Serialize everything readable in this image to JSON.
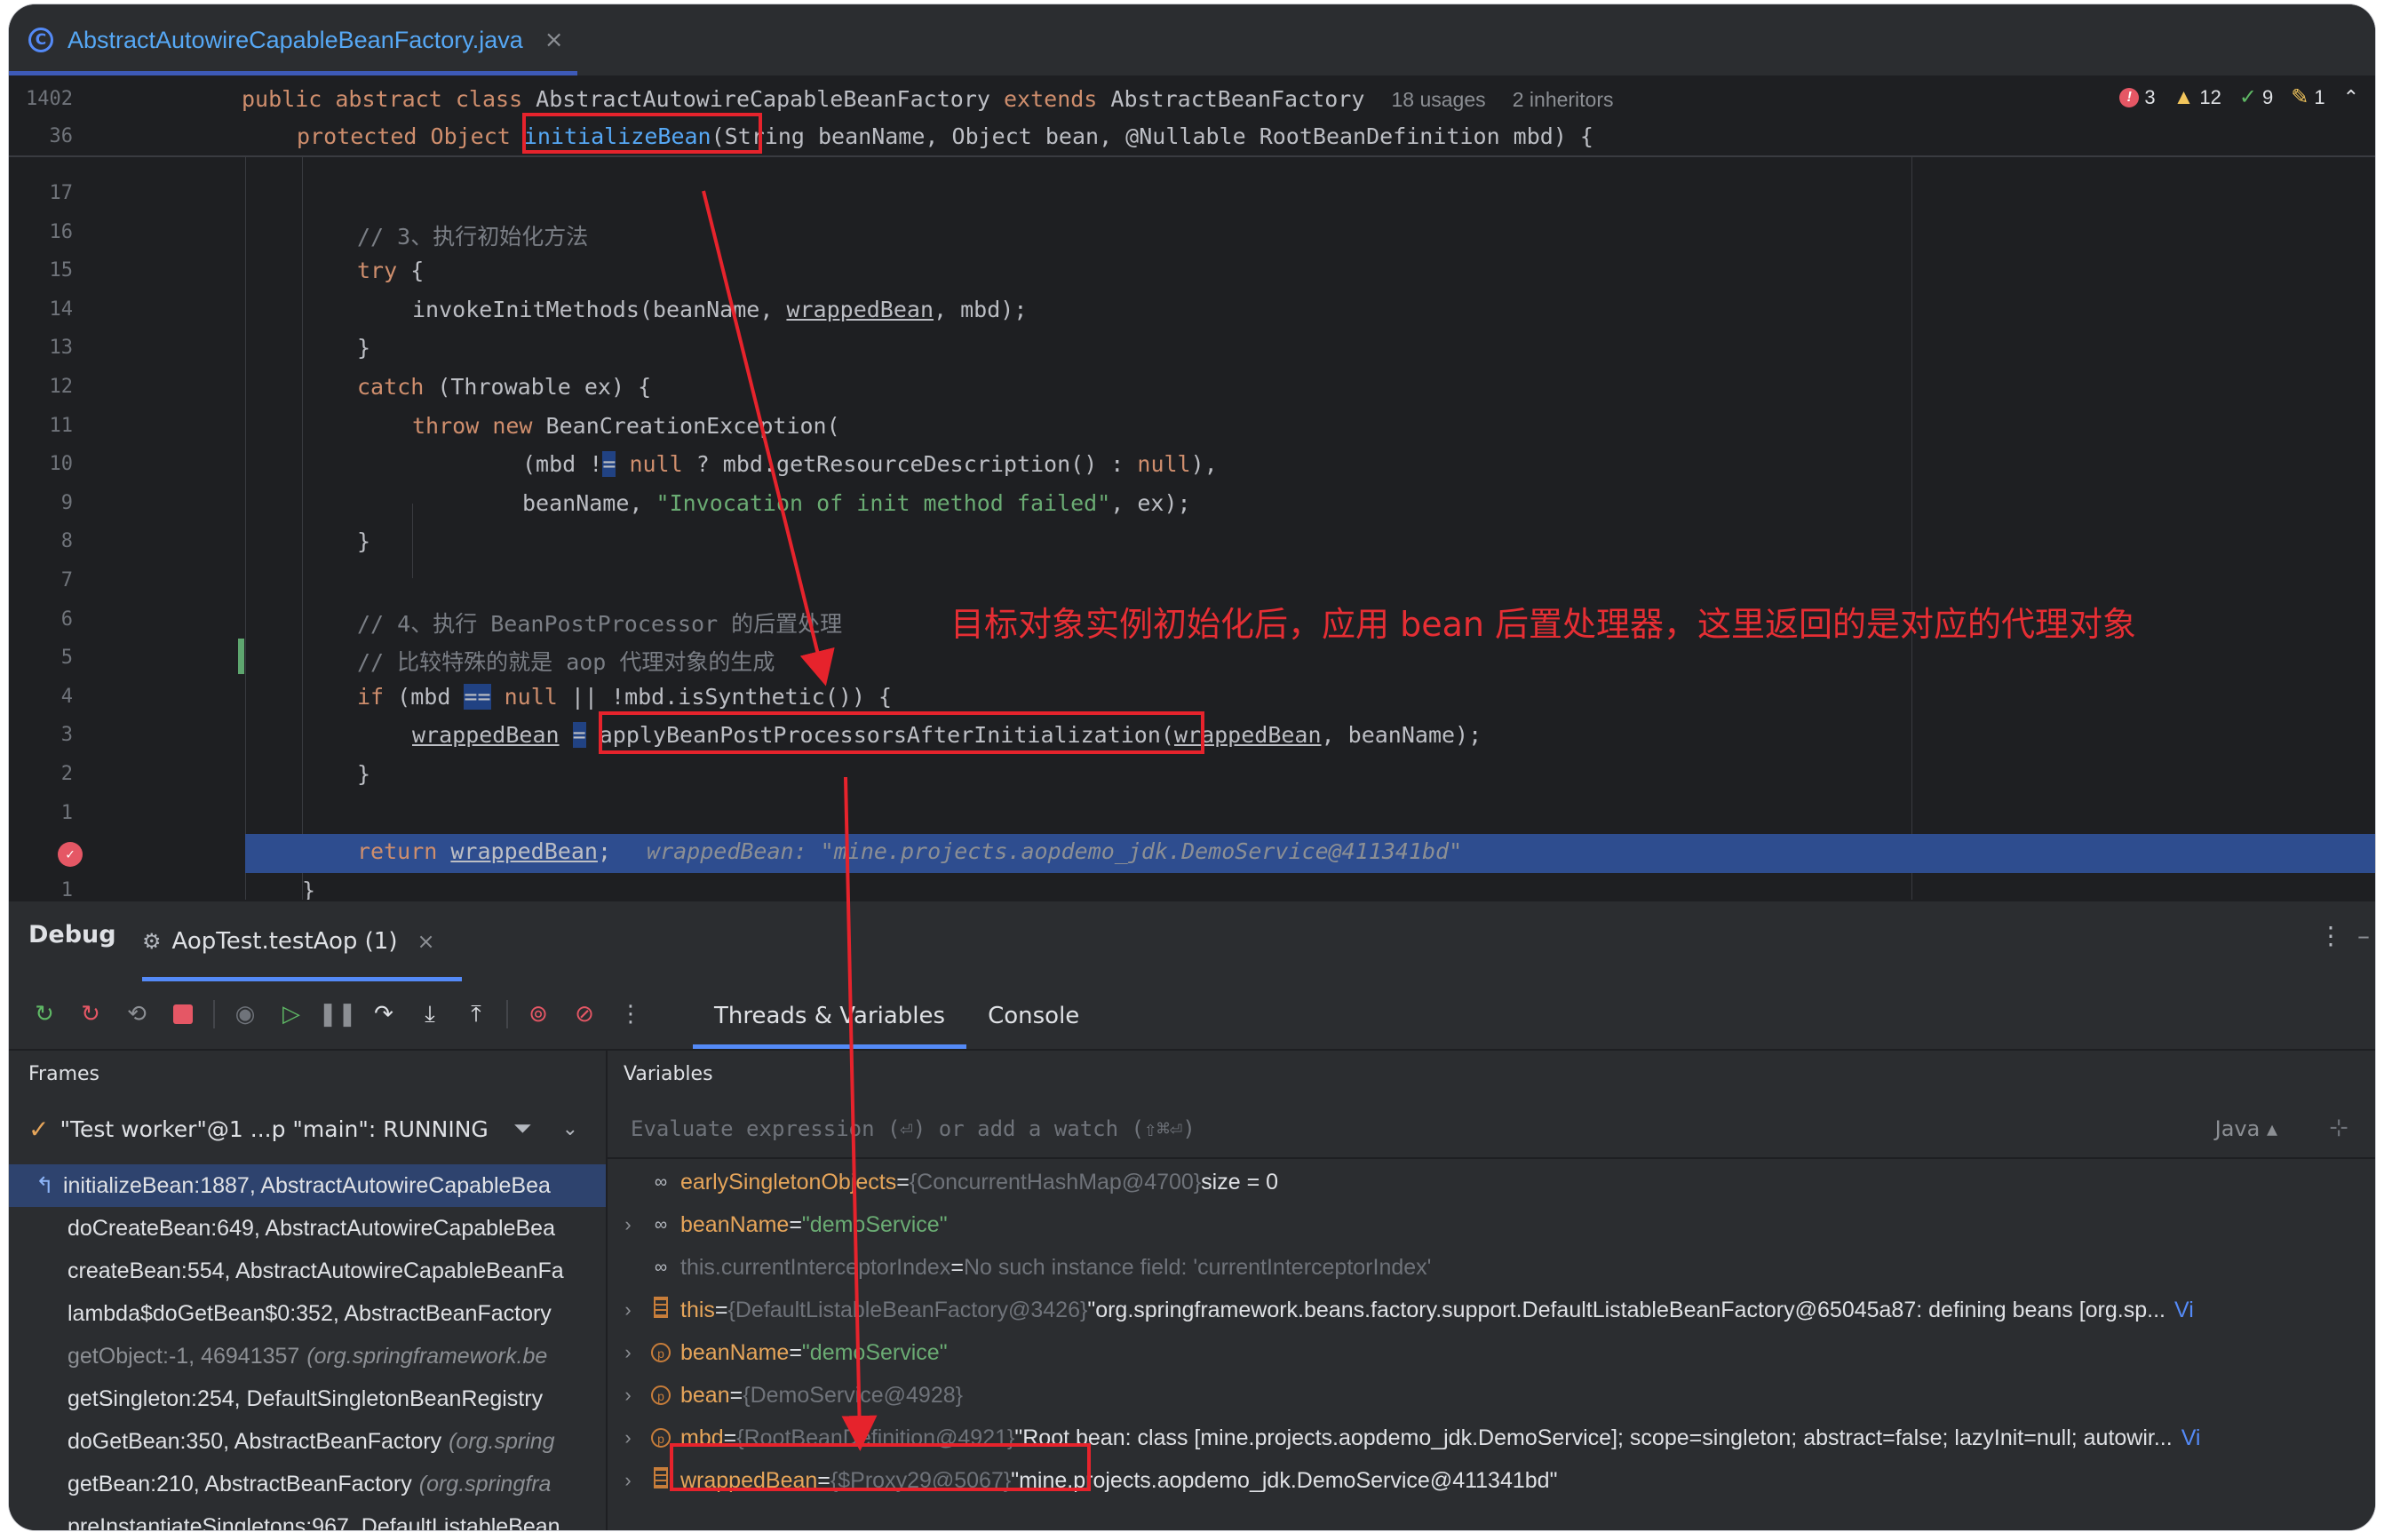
{
  "tab": {
    "filename": "AbstractAutowireCapableBeanFactory.java",
    "close": "×"
  },
  "sticky": {
    "line1_num": "1402",
    "line1_code": "public abstract class AbstractAutowireCapableBeanFactory extends AbstractBeanFactory",
    "usages": "18 usages",
    "inheritors": "2 inheritors",
    "line2_num": "36",
    "line2_prefix": "protected Object ",
    "line2_method": "initializeBean",
    "line2_rest": "(String beanName, Object bean, @Nullable RootBeanDefinition mbd) {"
  },
  "inspections": {
    "errors": "3",
    "warnings": "12",
    "ok": "9",
    "typos": "1"
  },
  "code_lines": [
    {
      "n": "17",
      "text": ""
    },
    {
      "n": "16",
      "text": "// 3、执行初始化方法"
    },
    {
      "n": "15",
      "text": "try {"
    },
    {
      "n": "14",
      "text": "invokeInitMethods(beanName, wrappedBean, mbd);"
    },
    {
      "n": "13",
      "text": "}"
    },
    {
      "n": "12",
      "text": "catch (Throwable ex) {"
    },
    {
      "n": "11",
      "text": "throw new BeanCreationException("
    },
    {
      "n": "10",
      "text": "(mbd != null ? mbd.getResourceDescription() : null),"
    },
    {
      "n": "9",
      "text": "beanName, \"Invocation of init method failed\", ex);"
    },
    {
      "n": "8",
      "text": "}"
    },
    {
      "n": "7",
      "text": ""
    },
    {
      "n": "6",
      "text": "// 4、执行 BeanPostProcessor 的后置处理"
    },
    {
      "n": "5",
      "text": "// 比较特殊的就是 aop 代理对象的生成"
    },
    {
      "n": "4",
      "text": "if (mbd == null || !mbd.isSynthetic()) {"
    },
    {
      "n": "3",
      "text": "wrappedBean = applyBeanPostProcessorsAfterInitialization(wrappedBean, beanName);"
    },
    {
      "n": "2",
      "text": "}"
    },
    {
      "n": "1",
      "text": ""
    },
    {
      "n": "",
      "text": "return wrappedBean;"
    },
    {
      "n": "1",
      "text": "}"
    }
  ],
  "inline_debug_value": "wrappedBean: \"mine.projects.aopdemo_jdk.DemoService@411341bd\"",
  "annotation": "目标对象实例初始化后，应用 bean 后置处理器，这里返回的是对应的代理对象",
  "debug": {
    "title": "Debug",
    "session_tab": "AopTest.testAop (1)",
    "view_tabs": [
      "Threads & Variables",
      "Console"
    ],
    "frames_header": "Frames",
    "variables_header": "Variables",
    "thread": "\"Test worker\"@1 ...p \"main\": RUNNING",
    "eval_placeholder": "Evaluate expression (⏎) or add a watch (⇧⌘⏎)",
    "eval_lang": "Java",
    "frames": [
      {
        "method": "initializeBean:1887, AbstractAutowireCapableBea",
        "loc": ""
      },
      {
        "method": "doCreateBean:649, AbstractAutowireCapableBea",
        "loc": ""
      },
      {
        "method": "createBean:554, AbstractAutowireCapableBeanFa",
        "loc": ""
      },
      {
        "method": "lambda$doGetBean$0:352, AbstractBeanFactory",
        "loc": ""
      },
      {
        "method": "getObject:-1, 46941357",
        "loc": "(org.springframework.be"
      },
      {
        "method": "getSingleton:254, DefaultSingletonBeanRegistry",
        "loc": ""
      },
      {
        "method": "doGetBean:350, AbstractBeanFactory",
        "loc": "(org.spring"
      },
      {
        "method": "getBean:210, AbstractBeanFactory",
        "loc": "(org.springfra"
      },
      {
        "method": "preInstantiateSingletons:967, DefaultListableBean",
        "loc": ""
      }
    ],
    "variables": [
      {
        "name": "earlySingletonObjects",
        "eq": " = ",
        "ref": "{ConcurrentHashMap@4700}",
        "val": "  size = 0"
      },
      {
        "name": "beanName",
        "eq": " = ",
        "ref": "",
        "val": "\"demoService\""
      },
      {
        "name": "this.currentInterceptorIndex",
        "eq": " = ",
        "ref": "",
        "val": "No such instance field: 'currentInterceptorIndex'"
      },
      {
        "name": "this",
        "eq": " = ",
        "ref": "{DefaultListableBeanFactory@3426}",
        "val": " \"org.springframework.beans.factory.support.DefaultListableBeanFactory@65045a87: defining beans [org.sp...",
        "link": "Vi"
      },
      {
        "name": "beanName",
        "eq": " = ",
        "ref": "",
        "val": "\"demoService\""
      },
      {
        "name": "bean",
        "eq": " = ",
        "ref": "{DemoService@4928}",
        "val": ""
      },
      {
        "name": "mbd",
        "eq": " = ",
        "ref": "{RootBeanDefinition@4921}",
        "val": " \"Root bean: class [mine.projects.aopdemo_jdk.DemoService]; scope=singleton; abstract=false; lazyInit=null; autowir...",
        "link": "Vi"
      },
      {
        "name": "wrappedBean",
        "eq": " = ",
        "ref": "{$Proxy29@5067}",
        "val": " \"mine.projects.aopdemo_jdk.DemoService@411341bd\""
      }
    ]
  },
  "colors": {
    "annotation_red": "#e62e34",
    "accent_blue": "#548af7",
    "exec_line": "#2e4d8f"
  },
  "icons": [
    "class-icon",
    "breakpoint-icon",
    "rerun-icon",
    "stop-icon",
    "resume-icon",
    "pause-icon",
    "step-over-icon",
    "step-into-icon",
    "step-out-icon",
    "filter-icon",
    "watch-icon",
    "field-icon",
    "parameter-icon"
  ]
}
